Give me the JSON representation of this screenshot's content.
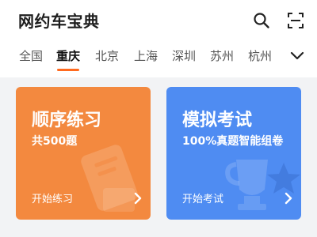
{
  "header": {
    "title": "网约车宝典",
    "search_icon": "search-icon",
    "scan_icon": "scan-icon"
  },
  "city_tabs": {
    "items": [
      {
        "label": "全国",
        "active": false
      },
      {
        "label": "重庆",
        "active": true
      },
      {
        "label": "北京",
        "active": false
      },
      {
        "label": "上海",
        "active": false
      },
      {
        "label": "深圳",
        "active": false
      },
      {
        "label": "苏州",
        "active": false
      },
      {
        "label": "杭州",
        "active": false
      }
    ],
    "more_icon": "chevron-down-icon",
    "active_color": "#ff6a1f"
  },
  "cards": {
    "practice": {
      "title": "顺序练习",
      "subtitle": "共500题",
      "cta": "开始练习",
      "color": "#f3893f",
      "icon": "document-icon"
    },
    "exam": {
      "title": "模拟考试",
      "subtitle": "100%真题智能组卷",
      "cta": "开始考试",
      "color": "#4f8cf2",
      "icon": "trophy-icon"
    }
  }
}
